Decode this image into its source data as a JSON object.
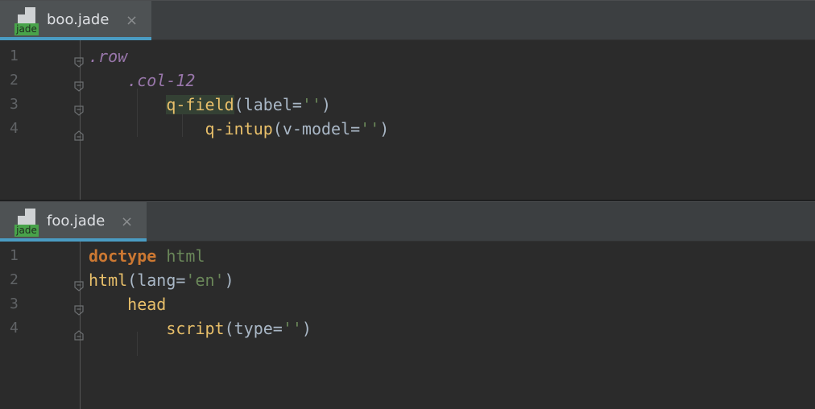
{
  "panes": [
    {
      "tab": {
        "title": "boo.jade",
        "icon_badge": "jade",
        "close_glyph": "×"
      },
      "lines": [
        {
          "num": "1",
          "tokens": [
            {
              "t": ".row",
              "c": "cls"
            }
          ]
        },
        {
          "num": "2",
          "tokens": [
            {
              "t": "    "
            },
            {
              "t": ".col-12",
              "c": "cls"
            }
          ]
        },
        {
          "num": "3",
          "tokens": [
            {
              "t": "        "
            },
            {
              "t": "q-field",
              "c": "tag",
              "hl": true
            },
            {
              "t": "(label="
            },
            {
              "t": "''",
              "c": "str"
            },
            {
              "t": ")"
            }
          ]
        },
        {
          "num": "4",
          "tokens": [
            {
              "t": "            "
            },
            {
              "t": "q-intup",
              "c": "tag"
            },
            {
              "t": "(v-model="
            },
            {
              "t": "''",
              "c": "str"
            },
            {
              "t": ")"
            }
          ]
        }
      ]
    },
    {
      "tab": {
        "title": "foo.jade",
        "icon_badge": "jade",
        "close_glyph": "×"
      },
      "lines": [
        {
          "num": "1",
          "tokens": [
            {
              "t": "doctype",
              "c": "kw"
            },
            {
              "t": " "
            },
            {
              "t": "html",
              "c": "str"
            }
          ]
        },
        {
          "num": "2",
          "tokens": [
            {
              "t": "html",
              "c": "tag"
            },
            {
              "t": "(lang="
            },
            {
              "t": "'en'",
              "c": "str"
            },
            {
              "t": ")"
            }
          ]
        },
        {
          "num": "3",
          "tokens": [
            {
              "t": "    "
            },
            {
              "t": "head",
              "c": "tag"
            }
          ]
        },
        {
          "num": "4",
          "tokens": [
            {
              "t": "        "
            },
            {
              "t": "script",
              "c": "tag"
            },
            {
              "t": "(type="
            },
            {
              "t": "''",
              "c": "str"
            },
            {
              "t": ")"
            }
          ]
        }
      ]
    }
  ]
}
